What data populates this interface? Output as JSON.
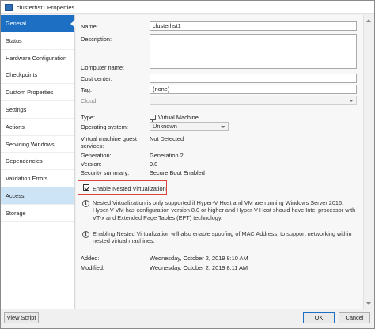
{
  "window": {
    "title": "clusterhst1 Properties"
  },
  "sidebar": {
    "items": [
      {
        "label": "General"
      },
      {
        "label": "Status"
      },
      {
        "label": "Hardware Configuration"
      },
      {
        "label": "Checkpoints"
      },
      {
        "label": "Custom Properties"
      },
      {
        "label": "Settings"
      },
      {
        "label": "Actions"
      },
      {
        "label": "Servicing Windows"
      },
      {
        "label": "Dependencies"
      },
      {
        "label": "Validation Errors"
      },
      {
        "label": "Access"
      },
      {
        "label": "Storage"
      }
    ]
  },
  "form": {
    "name_label": "Name:",
    "name_value": "clusterhst1",
    "description_label": "Description:",
    "computer_name_label": "Computer name:",
    "cost_center_label": "Cost center:",
    "tag_label": "Tag:",
    "tag_value": "(none)",
    "cloud_label": "Cloud:",
    "type_label": "Type:",
    "type_value": "Virtual Machine",
    "os_label": "Operating system:",
    "os_value": "Unknown",
    "guest_services_label_1": "Virtual machine guest",
    "guest_services_label_2": "services:",
    "guest_services_value": "Not Detected",
    "generation_label": "Generation:",
    "generation_value": "Generation 2",
    "version_label": "Version:",
    "version_value": "9.0",
    "security_label": "Security summary:",
    "security_value": "Secure Boot Enabled",
    "nested_virt_label": "Enable Nested Virtualization",
    "info_1": "Nested Virtualization is only supported if Hyper-V Host and VM are running Windows Server 2016. Hyper-V VM has configuration version 8.0 or higher and Hyper-V Host should have Intel processor with VT-x and Extended Page Tables (EPT) technology.",
    "info_2": "Enabling Nested Virtualization will also enable spoofing of MAC Address, to support networking within nested virtual machines.",
    "added_label": "Added:",
    "added_value": "Wednesday, October 2, 2019 8:10 AM",
    "modified_label": "Modified:",
    "modified_value": "Wednesday, October 2, 2019 8:11 AM"
  },
  "footer": {
    "view_script_label": "View Script",
    "ok_label": "OK",
    "cancel_label": "Cancel"
  },
  "colors": {
    "active_nav": "#1c6fc2",
    "highlight_border": "#d9453d"
  },
  "icons": {
    "title": "window-properties-icon",
    "vm": "virtual-machine-icon",
    "info": "info-icon"
  }
}
